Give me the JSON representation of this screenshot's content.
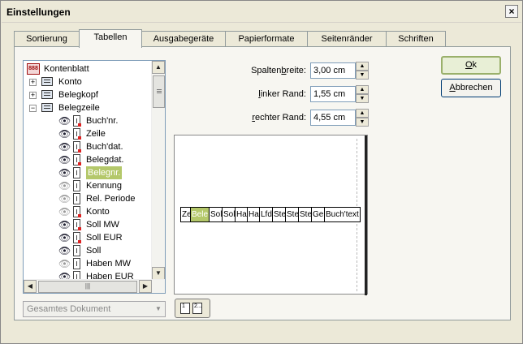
{
  "window": {
    "title": "Einstellungen",
    "close_glyph": "×"
  },
  "tabs": [
    {
      "label": "Sortierung"
    },
    {
      "label": "Tabellen",
      "active": true
    },
    {
      "label": "Ausgabegeräte"
    },
    {
      "label": "Papierformate"
    },
    {
      "label": "Seitenränder"
    },
    {
      "label": "Schriften"
    }
  ],
  "tree": {
    "root": {
      "label": "Kontenblatt",
      "icon": "book-icon",
      "icon_text": "888"
    },
    "groups": [
      {
        "label": "Konto",
        "expander": "+"
      },
      {
        "label": "Belegkopf",
        "expander": "+"
      },
      {
        "label": "Belegzeile",
        "expander": "−"
      }
    ],
    "fields": [
      {
        "label": "Buch'nr.",
        "visible": true,
        "marker": true
      },
      {
        "label": "Zeile",
        "visible": true,
        "marker": true
      },
      {
        "label": "Buch'dat.",
        "visible": true,
        "marker": true
      },
      {
        "label": "Belegdat.",
        "visible": true,
        "marker": true
      },
      {
        "label": "Belegnr.",
        "visible": true,
        "marker": false,
        "selected": true
      },
      {
        "label": "Kennung",
        "visible": false,
        "marker": false
      },
      {
        "label": "Rel. Periode",
        "visible": false,
        "marker": false
      },
      {
        "label": "Konto",
        "visible": false,
        "marker": true
      },
      {
        "label": "Soll MW",
        "visible": true,
        "marker": true
      },
      {
        "label": "Soll EUR",
        "visible": true,
        "marker": true
      },
      {
        "label": "Soll",
        "visible": true,
        "marker": false
      },
      {
        "label": "Haben MW",
        "visible": false,
        "marker": false
      },
      {
        "label": "Haben EUR",
        "visible": true,
        "marker": false
      }
    ],
    "hscroll_grip": "|||",
    "scroll_up": "▲",
    "scroll_down": "▼",
    "scroll_left": "◀",
    "scroll_right": "▶"
  },
  "settings": {
    "spaltenbreite": {
      "label_pre": "Spalten",
      "label_u": "b",
      "label_post": "reite:",
      "value": "3,00 cm"
    },
    "linker_rand": {
      "label_pre": "",
      "label_u": "l",
      "label_post": "inker Rand:",
      "value": "1,55 cm"
    },
    "rechter_rand": {
      "label_pre": "",
      "label_u": "r",
      "label_post": "echter Rand:",
      "value": "4,55 cm"
    }
  },
  "preview": {
    "columns": [
      "Ze",
      "Bele",
      "Sol",
      "Sol",
      "Ha",
      "Ha",
      "Lfd",
      "Ste",
      "Ste",
      "Ste",
      "Ge",
      "Buch'text"
    ],
    "selected_index": 1
  },
  "buttons": {
    "ok_u": "O",
    "ok_rest": "k",
    "cancel_u": "A",
    "cancel_rest": "bbrechen"
  },
  "scope_dropdown": {
    "value": "Gesamtes Dokument"
  },
  "page_button": {
    "page1": "1",
    "page2": "2..."
  }
}
